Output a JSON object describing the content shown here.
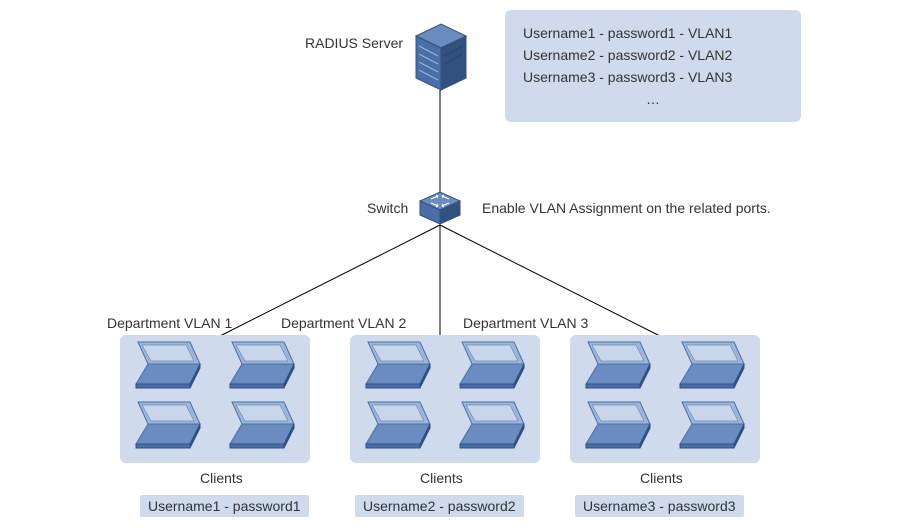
{
  "radius_label": "RADIUS Server",
  "switch_label": "Switch",
  "switch_note": "Enable VLAN Assignment on the related ports.",
  "departments": {
    "d1": "Department VLAN 1",
    "d2": "Department VLAN 2",
    "d3": "Department VLAN 3"
  },
  "clients_label": "Clients",
  "credentials": {
    "c1": "Username1 - password1",
    "c2": "Username2 - password2",
    "c3": "Username3 - password3"
  },
  "config": {
    "line1": "Username1 - password1 - VLAN1",
    "line2": "Username2 - password2 - VLAN2",
    "line3": "Username3 - password3 - VLAN3",
    "ellipsis": "…"
  },
  "icons": {
    "server": "server-icon",
    "switch": "switch-icon",
    "laptop": "laptop-icon"
  },
  "colors": {
    "panel": "#cfdbed",
    "device_fill": "#4a6ea8",
    "device_light": "#9db6d8",
    "device_dark": "#33517f"
  }
}
